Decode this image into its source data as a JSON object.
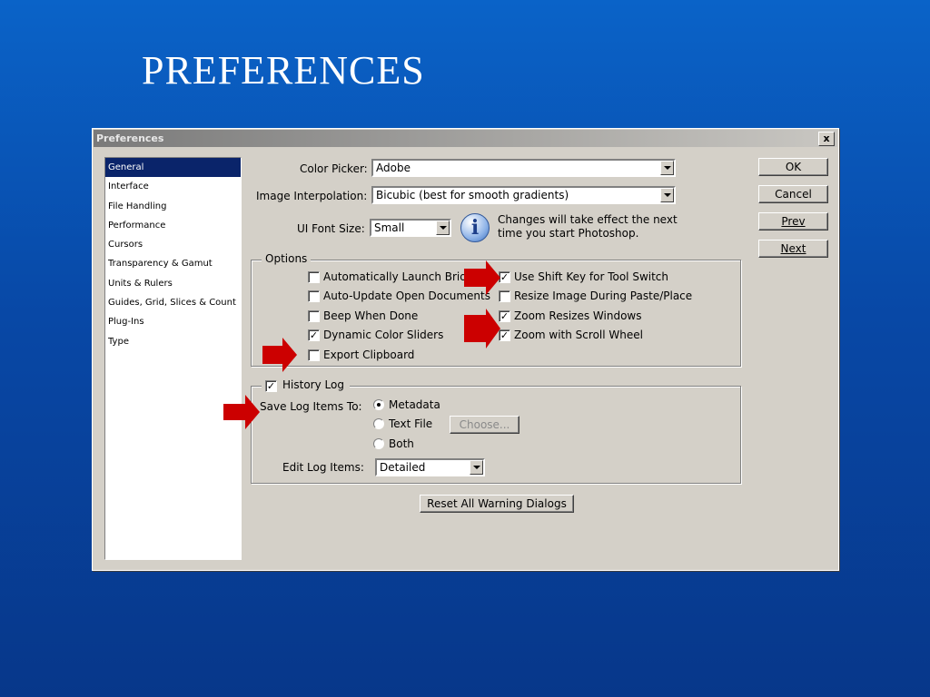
{
  "slide": {
    "title": "PREFERENCES"
  },
  "dialog": {
    "title": "Preferences",
    "close_label": "x",
    "categories": [
      "General",
      "Interface",
      "File Handling",
      "Performance",
      "Cursors",
      "Transparency & Gamut",
      "Units & Rulers",
      "Guides, Grid, Slices & Count",
      "Plug-Ins",
      "Type"
    ],
    "selected_category": "General",
    "color_picker": {
      "label": "Color Picker:",
      "value": "Adobe"
    },
    "interpolation": {
      "label": "Image Interpolation:",
      "value": "Bicubic (best for smooth gradients)"
    },
    "ui_font": {
      "label": "UI Font Size:",
      "value": "Small"
    },
    "info_text": [
      "Changes will take effect the next",
      "time you start Photoshop."
    ],
    "buttons": {
      "ok": "OK",
      "cancel": "Cancel",
      "prev": "Prev",
      "next": "Next"
    },
    "options": {
      "title": "Options",
      "left": [
        {
          "label": "Automatically Launch Bridge",
          "checked": false
        },
        {
          "label": "Auto-Update Open Documents",
          "checked": false
        },
        {
          "label": "Beep When Done",
          "checked": false
        },
        {
          "label": "Dynamic Color Sliders",
          "checked": true
        },
        {
          "label": "Export Clipboard",
          "checked": false
        }
      ],
      "right": [
        {
          "label": "Use Shift Key for Tool Switch",
          "checked": true
        },
        {
          "label": "Resize Image During Paste/Place",
          "checked": false
        },
        {
          "label": "Zoom Resizes Windows",
          "checked": true
        },
        {
          "label": "Zoom with Scroll Wheel",
          "checked": true
        }
      ]
    },
    "history": {
      "title": "History Log",
      "checked": true,
      "save_label": "Save Log Items To:",
      "radios": [
        {
          "label": "Metadata",
          "selected": true
        },
        {
          "label": "Text File",
          "selected": false
        },
        {
          "label": "Both",
          "selected": false
        }
      ],
      "choose_label": "Choose...",
      "edit_label": "Edit Log Items:",
      "edit_value": "Detailed"
    },
    "reset_label": "Reset All Warning Dialogs"
  },
  "accent_colors": {
    "annotation_arrow": "#cc0000",
    "selection": "#0a246a"
  }
}
